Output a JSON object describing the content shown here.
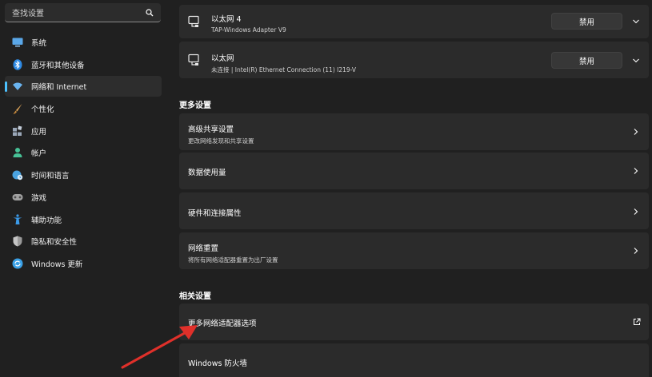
{
  "sidebar": {
    "search_placeholder": "查找设置",
    "items": [
      {
        "label": "系统",
        "icon": "monitor-icon",
        "color": "#5aa7e8"
      },
      {
        "label": "蓝牙和其他设备",
        "icon": "bluetooth-icon",
        "color": "#2f8be5"
      },
      {
        "label": "网络和 Internet",
        "icon": "wifi-icon",
        "color": "#6ab4f0",
        "active": true
      },
      {
        "label": "个性化",
        "icon": "brush-icon",
        "color": "#e0a75b"
      },
      {
        "label": "应用",
        "icon": "apps-icon",
        "color": "#9aa7b8"
      },
      {
        "label": "帐户",
        "icon": "person-icon",
        "color": "#47c196"
      },
      {
        "label": "时间和语言",
        "icon": "globe-clock-icon",
        "color": "#4aa3e0"
      },
      {
        "label": "游戏",
        "icon": "gamepad-icon",
        "color": "#a0a0a0"
      },
      {
        "label": "辅助功能",
        "icon": "accessibility-icon",
        "color": "#3b9ae8"
      },
      {
        "label": "隐私和安全性",
        "icon": "shield-icon",
        "color": "#9a9a9a"
      },
      {
        "label": "Windows 更新",
        "icon": "update-icon",
        "color": "#3aa0e6"
      }
    ]
  },
  "adapters": [
    {
      "name": "以太网 4",
      "detail": "TAP-Windows Adapter V9",
      "button": "禁用"
    },
    {
      "name": "以太网",
      "detail": "未连接 | Intel(R) Ethernet Connection (11) I219-V",
      "button": "禁用"
    }
  ],
  "more_settings": {
    "title": "更多设置",
    "items": [
      {
        "title": "高级共享设置",
        "subtitle": "更改网络发现和共享设置"
      },
      {
        "title": "数据使用量"
      },
      {
        "title": "硬件和连接属性"
      },
      {
        "title": "网络重置",
        "subtitle": "将所有网络适配器重置为出厂设置"
      }
    ]
  },
  "related_settings": {
    "title": "相关设置",
    "items": [
      {
        "title": "更多网络适配器选项"
      },
      {
        "title": "Windows 防火墙"
      }
    ]
  },
  "colors": {
    "accent": "#4cc2ff",
    "annotation_arrow": "#e0302a"
  }
}
